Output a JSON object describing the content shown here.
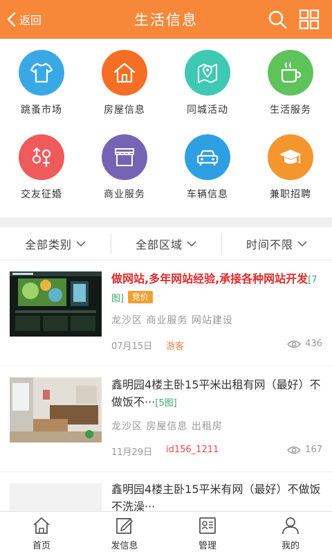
{
  "header": {
    "back_label": "返回",
    "title": "生活信息"
  },
  "categories": [
    {
      "label": "跳蚤市场",
      "color": "#3ba8e6",
      "icon": "tshirt-icon"
    },
    {
      "label": "房屋信息",
      "color": "#f56e24",
      "icon": "house-icon"
    },
    {
      "label": "同城活动",
      "color": "#3fc9b4",
      "icon": "map-pin-icon"
    },
    {
      "label": "生活服务",
      "color": "#5ec35a",
      "icon": "coffee-cup-icon"
    },
    {
      "label": "交友征婚",
      "color": "#ef5a5a",
      "icon": "gender-icon"
    },
    {
      "label": "商业服务",
      "color": "#7564b4",
      "icon": "shop-icon"
    },
    {
      "label": "车辆信息",
      "color": "#2f9fe3",
      "icon": "car-icon"
    },
    {
      "label": "兼职招聘",
      "color": "#f4952e",
      "icon": "graduation-cap-icon"
    }
  ],
  "filters": [
    "全部类别",
    "全部区域",
    "时间不限"
  ],
  "listings": [
    {
      "title": "做网站,多年网站经验,承接各种网站开发",
      "img_count": "[7图]",
      "badge": "竞价",
      "tags": "龙沙区 商业服务 网站建设",
      "date": "07月15日",
      "user": "游客",
      "user_color": "#f4824b",
      "views": "436"
    },
    {
      "title": "鑫明园4楼主卧15平米出租有网（最好）不做饭不···",
      "img_count": "[5图]",
      "tags": "龙沙区 房屋信息 出租房",
      "date": "11月29日",
      "user": "id156_1211",
      "user_color": "#e84a4a",
      "views": "167"
    },
    {
      "title": "鑫明园4楼主卧15平米有网（最好）不做饭不洗澡···"
    }
  ],
  "tabs": [
    {
      "label": "首页",
      "icon": "home-icon"
    },
    {
      "label": "发信息",
      "icon": "edit-icon"
    },
    {
      "label": "管理",
      "icon": "id-card-icon"
    },
    {
      "label": "我的",
      "icon": "user-icon"
    }
  ]
}
